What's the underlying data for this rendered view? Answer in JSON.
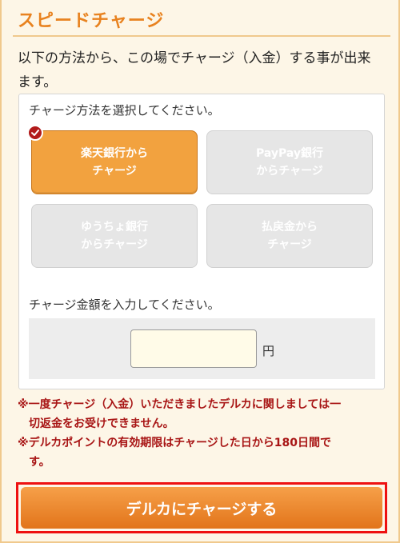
{
  "header": {
    "title": "スピードチャージ"
  },
  "intro": {
    "line1": "以下の方法から、この場でチャージ（入金）する事が出来",
    "line2": "ます。"
  },
  "method_section": {
    "label": "チャージ方法を選択してください。",
    "options": [
      {
        "line1": "楽天銀行から",
        "line2": "チャージ",
        "selected": true
      },
      {
        "line1": "PayPay銀行",
        "line2": "からチャージ",
        "selected": false
      },
      {
        "line1": "ゆうちょ銀行",
        "line2": "からチャージ",
        "selected": false
      },
      {
        "line1": "払戻金から",
        "line2": "チャージ",
        "selected": false
      }
    ]
  },
  "amount_section": {
    "label": "チャージ金額を入力してください。",
    "input_value": "",
    "unit": "円"
  },
  "notes": [
    {
      "line1": "※一度チャージ（入金）いただきましたデルカに関しましては一",
      "line2": "切返金をお受けできません。"
    },
    {
      "line1": "※デルカポイントの有効期限はチャージした日から180日間で",
      "line2": "す。"
    }
  ],
  "cta": {
    "label": "デルカにチャージする"
  },
  "colors": {
    "accent": "#e8821f",
    "selected_button": "#f2a23f",
    "inactive_button": "#e6e6e6",
    "notice_text": "#a81515",
    "highlight_border": "#ee1111"
  }
}
